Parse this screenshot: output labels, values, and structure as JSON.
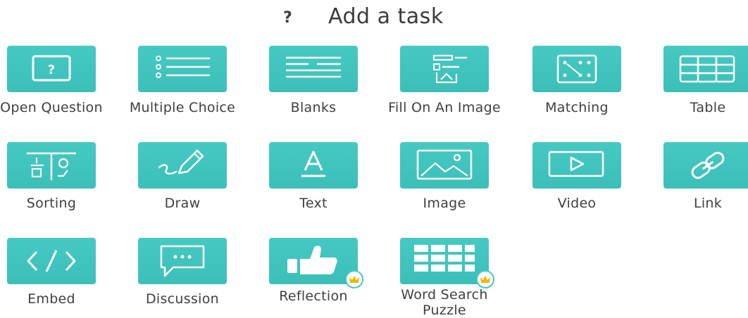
{
  "header": {
    "help_icon": "?",
    "title": "Add a task"
  },
  "tasks": [
    {
      "label": "Open Question",
      "icon": "question-box-icon"
    },
    {
      "label": "Multiple Choice",
      "icon": "list-icon"
    },
    {
      "label": "Blanks",
      "icon": "lines-icon"
    },
    {
      "label": "Fill On An Image",
      "icon": "image-fill-icon"
    },
    {
      "label": "Matching",
      "icon": "matching-icon"
    },
    {
      "label": "Table",
      "icon": "table-icon"
    },
    {
      "label": "Sorting",
      "icon": "sorting-icon"
    },
    {
      "label": "Draw",
      "icon": "pencil-icon"
    },
    {
      "label": "Text",
      "icon": "text-icon"
    },
    {
      "label": "Image",
      "icon": "picture-icon"
    },
    {
      "label": "Video",
      "icon": "video-icon"
    },
    {
      "label": "Link",
      "icon": "link-icon"
    },
    {
      "label": "Embed",
      "icon": "code-icon"
    },
    {
      "label": "Discussion",
      "icon": "speech-bubble-icon"
    },
    {
      "label": "Reflection",
      "icon": "thumbs-up-icon",
      "premium": true
    },
    {
      "label": "Word Search Puzzle",
      "icon": "grid-icon",
      "premium": true
    }
  ],
  "colors": {
    "tile": "#46c9c3",
    "crown": "#f2b705"
  }
}
